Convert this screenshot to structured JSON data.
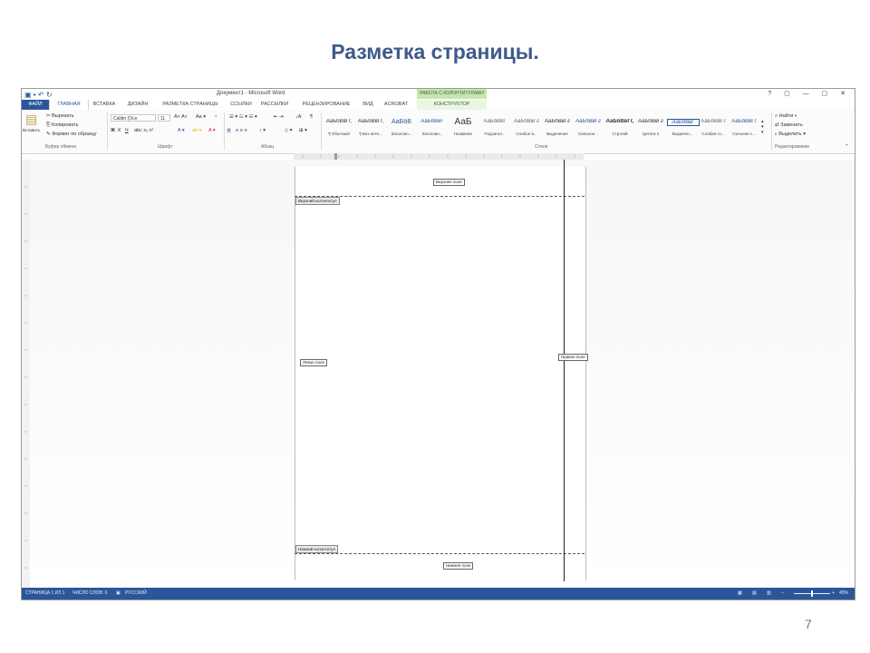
{
  "slide": {
    "title": "Разметка страницы.",
    "number": "7"
  },
  "window": {
    "doc_title": "Документ1 - Microsoft Word",
    "context_group": "РАБОТА С КОЛОНТИТУЛАМИ",
    "controls": "? ▢ — ▢ ✕"
  },
  "tabs": {
    "file": "ФАЙЛ",
    "home": "ГЛАВНАЯ",
    "insert": "ВСТАВКА",
    "design": "ДИЗАЙН",
    "layout": "РАЗМЕТКА СТРАНИЦЫ",
    "references": "ССЫЛКИ",
    "mailings": "РАССЫЛКИ",
    "review": "РЕЦЕНЗИРОВАНИЕ",
    "view": "ВИД",
    "acrobat": "ACROBAT",
    "constructor": "КОНСТРУКТОР"
  },
  "ribbon": {
    "clipboard": {
      "paste": "Вставить",
      "cut": "Вырезать",
      "copy": "Копировать",
      "format_painter": "Формат по образцу",
      "label": "Буфер обмена"
    },
    "font": {
      "name": "Calibri (Осн",
      "size": "11",
      "label": "Шрифт",
      "bold": "Ж",
      "italic": "К",
      "underline": "Ч"
    },
    "paragraph": {
      "label": "Абзац"
    },
    "styles": {
      "label": "Стили",
      "items": [
        {
          "preview": "АаБбВвГг,",
          "name": "¶ Обычный"
        },
        {
          "preview": "АаБбВвГг,",
          "name": "¶ Без инте..."
        },
        {
          "preview": "АаБбВ",
          "name": "Заголово..."
        },
        {
          "preview": "АаБбВеГ",
          "name": "Заголово..."
        },
        {
          "preview": "АаБ",
          "name": "Название"
        },
        {
          "preview": "АаБбВвГ",
          "name": "Подзагол..."
        },
        {
          "preview": "АаБбВвГг",
          "name": "Слабое в..."
        },
        {
          "preview": "АаБбВвГг",
          "name": "Выделение"
        },
        {
          "preview": "АаБбВвГг",
          "name": "Сильное..."
        },
        {
          "preview": "АаБбВвГг,",
          "name": "Строгий"
        },
        {
          "preview": "АаБбВвГг",
          "name": "Цитата 2"
        },
        {
          "preview": "АаБбВвГ",
          "name": "Выделен..."
        },
        {
          "preview": "АаБбВвГг",
          "name": "Слабая сс..."
        },
        {
          "preview": "АаБбВвГг",
          "name": "Сильная с..."
        }
      ]
    },
    "editing": {
      "find": "Найти",
      "replace": "Заменить",
      "select": "Выделить",
      "label": "Редактирование"
    }
  },
  "document": {
    "top_margin_field": "Верхнее поле",
    "header_tag": "Верхний колонтитул",
    "left_margin_field": "Левое поле",
    "right_margin_field": "Правое поле",
    "footer_tag": "Нижний колонтитул",
    "bottom_margin_field": "Нижнее поле"
  },
  "statusbar": {
    "page": "СТРАНИЦА 1 ИЗ 1",
    "words": "ЧИСЛО СЛОВ: 0",
    "lang": "РУССКИЙ",
    "zoom": "45%"
  },
  "colors": {
    "accent": "#2b579a",
    "context_tab": "#c5e6b0",
    "title": "#3d5a8a"
  }
}
